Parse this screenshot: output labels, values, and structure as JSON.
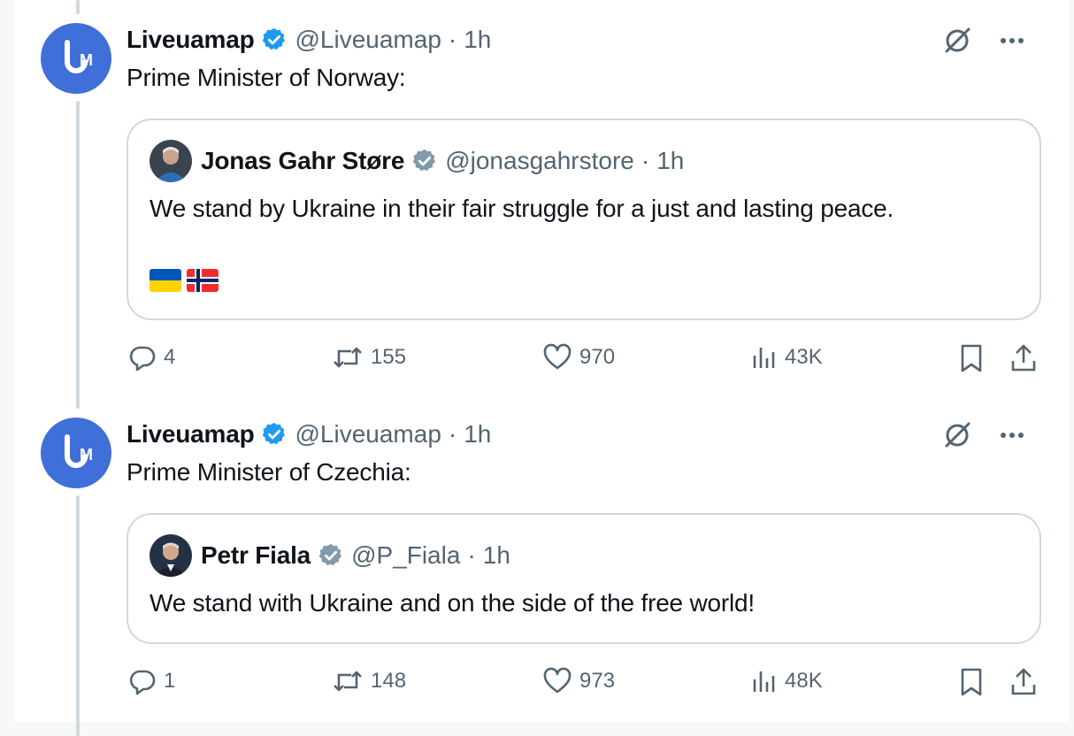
{
  "posts": [
    {
      "author_name": "Liveuamap",
      "handle": "@Liveuamap",
      "separator": "·",
      "time": "1h",
      "avatar_letters": "UM",
      "text": "Prime Minister of Norway:",
      "quote": {
        "author_name": "Jonas Gahr Støre",
        "handle": "@jonasgahrstore",
        "separator": "·",
        "time": "1h",
        "text": "We stand by Ukraine in their fair struggle for a just and lasting peace.",
        "flags": [
          "ukraine-flag",
          "norway-flag"
        ]
      },
      "replies": "4",
      "reposts": "155",
      "likes": "970",
      "views": "43K"
    },
    {
      "author_name": "Liveuamap",
      "handle": "@Liveuamap",
      "separator": "·",
      "time": "1h",
      "avatar_letters": "UM",
      "text": "Prime Minister of Czechia:",
      "quote": {
        "author_name": "Petr Fiala",
        "handle": "@P_Fiala",
        "separator": "·",
        "time": "1h",
        "text": "We stand with Ukraine and on the side of the free world!"
      },
      "replies": "1",
      "reposts": "148",
      "likes": "973",
      "views": "48K"
    }
  ],
  "colors": {
    "verified_blue": "#1d9bf0",
    "verified_gray": "#829aab",
    "muted_text": "#536471",
    "border": "#cfd9de",
    "avatar_blue": "#3f6fd8"
  },
  "icons": [
    "verified-badge-icon",
    "grok-icon",
    "more-icon",
    "reply-icon",
    "repost-icon",
    "like-icon",
    "views-icon",
    "bookmark-icon",
    "share-icon"
  ]
}
